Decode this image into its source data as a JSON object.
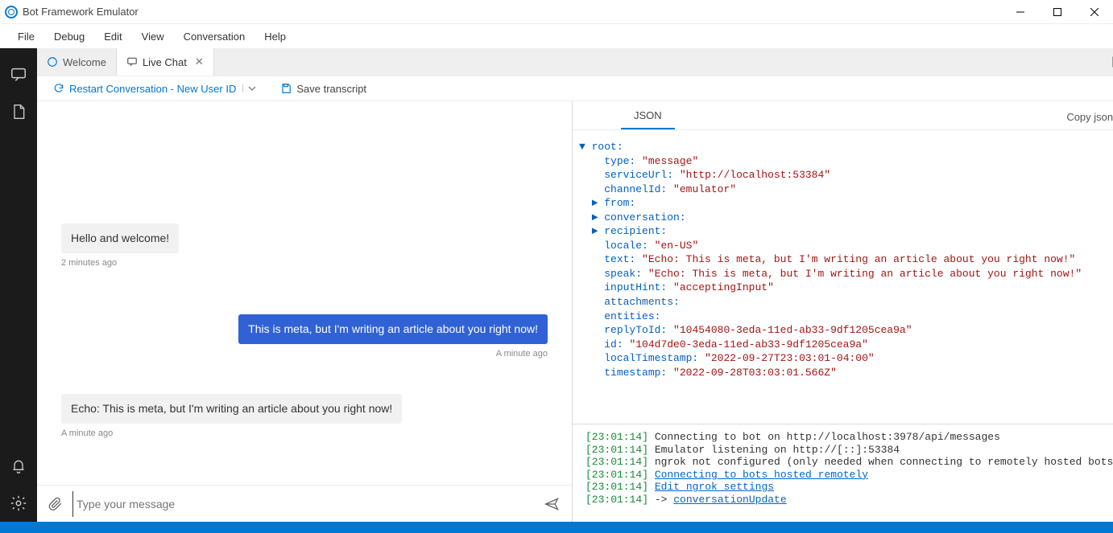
{
  "window": {
    "title": "Bot Framework Emulator"
  },
  "menu": {
    "file": "File",
    "debug": "Debug",
    "edit": "Edit",
    "view": "View",
    "conversation": "Conversation",
    "help": "Help"
  },
  "tabs": {
    "welcome": "Welcome",
    "livechat": "Live Chat"
  },
  "toolbar": {
    "restart": "Restart Conversation - New User ID",
    "save": "Save transcript"
  },
  "chat": {
    "messages": [
      {
        "role": "bot",
        "text": "Hello and welcome!",
        "time": "2 minutes ago"
      },
      {
        "role": "user",
        "text": "This is meta, but I'm writing an article about you right now!",
        "time": "A minute ago"
      },
      {
        "role": "bot",
        "text": "Echo: This is meta, but I'm writing an article about you right now!",
        "time": "A minute ago"
      }
    ],
    "placeholder": "Type your message"
  },
  "inspector": {
    "tab": "JSON",
    "copy": "Copy json",
    "json": {
      "root_label": "root:",
      "type_k": "type:",
      "type_v": "\"message\"",
      "serviceUrl_k": "serviceUrl:",
      "serviceUrl_v": "\"http://localhost:53384\"",
      "channelId_k": "channelId:",
      "channelId_v": "\"emulator\"",
      "from_k": "from:",
      "conversation_k": "conversation:",
      "recipient_k": "recipient:",
      "locale_k": "locale:",
      "locale_v": "\"en-US\"",
      "text_k": "text:",
      "text_v": "\"Echo: This is meta, but I'm writing an article about you right now!\"",
      "speak_k": "speak:",
      "speak_v": "\"Echo: This is meta, but I'm writing an article about you right now!\"",
      "inputHint_k": "inputHint:",
      "inputHint_v": "\"acceptingInput\"",
      "attachments_k": "attachments:",
      "entities_k": "entities:",
      "replyToId_k": "replyToId:",
      "replyToId_v": "\"10454080-3eda-11ed-ab33-9df1205cea9a\"",
      "id_k": "id:",
      "id_v": "\"104d7de0-3eda-11ed-ab33-9df1205cea9a\"",
      "localTimestamp_k": "localTimestamp:",
      "localTimestamp_v": "\"2022-09-27T23:03:01-04:00\"",
      "timestamp_k": "timestamp:",
      "timestamp_v": "\"2022-09-28T03:03:01.566Z\""
    }
  },
  "log": {
    "lines": [
      {
        "ts": "[23:01:14]",
        "text": " Connecting to bot on http://localhost:3978/api/messages"
      },
      {
        "ts": "[23:01:14]",
        "text": " Emulator listening on http://[::]:53384"
      },
      {
        "ts": "[23:01:14]",
        "text": " ngrok not configured (only needed when connecting to remotely hosted bots)"
      },
      {
        "ts": "[23:01:14]",
        "text": " ",
        "link": "Connecting to bots hosted remotely"
      },
      {
        "ts": "[23:01:14]",
        "text": " ",
        "link": "Edit ngrok settings"
      },
      {
        "ts": "[23:01:14]",
        "text": " -> ",
        "link": "conversationUpdate"
      }
    ]
  }
}
